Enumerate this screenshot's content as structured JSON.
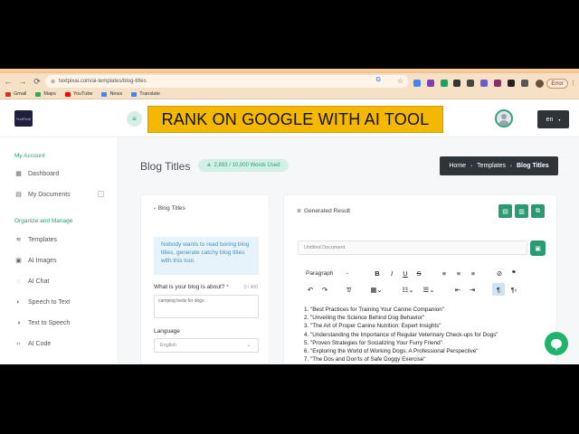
{
  "browser": {
    "url": "textpixai.com/ai-templates/blog-titles",
    "error_label": "Error",
    "bookmarks": [
      {
        "label": "Gmail",
        "color": "#d93025"
      },
      {
        "label": "Maps",
        "color": "#34a853"
      },
      {
        "label": "YouTube",
        "color": "#ff0000"
      },
      {
        "label": "News",
        "color": "#4285f4"
      },
      {
        "label": "Translate",
        "color": "#4285f4"
      }
    ]
  },
  "header": {
    "logo_text": "TextPixAI",
    "banner": "RANK ON GOOGLE WITH AI TOOL",
    "language": "en"
  },
  "sidebar": {
    "section1": "My Account",
    "section2": "Organize and Manage",
    "items": [
      {
        "label": "Dashboard",
        "icon": "grid-icon"
      },
      {
        "label": "My Documents",
        "icon": "document-icon"
      },
      {
        "label": "Templates",
        "icon": "layers-icon"
      },
      {
        "label": "AI Images",
        "icon": "image-icon"
      },
      {
        "label": "AI Chat",
        "icon": "chat-icon"
      },
      {
        "label": "Speech to Text",
        "icon": "speech-icon"
      },
      {
        "label": "Text to Speech",
        "icon": "speaker-icon"
      },
      {
        "label": "AI Code",
        "icon": "code-icon"
      }
    ]
  },
  "main": {
    "title": "Blog Titles",
    "words_used": "2,893 / 10,000 Words Used",
    "breadcrumb": [
      "Home",
      "Templates",
      "Blog Titles"
    ]
  },
  "form": {
    "title": "Blog Titles",
    "hint": "Nobody wants to read boring blog titles, generate catchy blog titles with this tool.",
    "question_label": "What is your blog is about?",
    "counter": "0 / 400",
    "topic_value": "camping beds for dogs",
    "language_label": "Language",
    "language_value": "English"
  },
  "result": {
    "title": "Generated Result",
    "doc_placeholder": "Untitled Document",
    "paragraph_style": "Paragraph",
    "items": [
      "1. \"Best Practices for Training Your Canine Companion\"",
      "2. \"Unveiling the Science Behind Dog Behavior\"",
      "3. \"The Art of Proper Canine Nutrition: Expert Insights\"",
      "4. \"Understanding the Importance of Regular Veterinary Check-ups for Dogs\"",
      "5. \"Proven Strategies for Socializing Your Furry Friend\"",
      "6. \"Exploring the World of Working Dogs: A Professional Perspective\"",
      "7. \"The Dos and Don'ts of Safe Doggy Exercise\""
    ]
  }
}
